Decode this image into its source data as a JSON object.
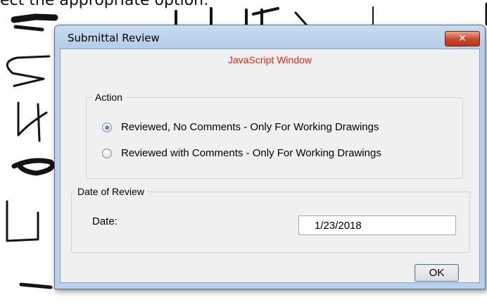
{
  "background": {
    "caption": "ect the appropriate option:"
  },
  "dialog": {
    "title": "Submittal Review",
    "close_label": "✕",
    "subtitle": "JavaScript Window",
    "action_group": {
      "legend": "Action",
      "options": [
        {
          "label": "Reviewed, No Comments - Only For Working Drawings",
          "checked": true
        },
        {
          "label": "Reviewed with Comments - Only For Working Drawings",
          "checked": false
        }
      ]
    },
    "date_group": {
      "legend": "Date of Review",
      "date_label": "Date:",
      "date_value": "1/23/2018"
    },
    "ok_label": "OK"
  },
  "colors": {
    "subtitle": "#e8221a",
    "window_frame": "#b9d1ea",
    "close_button": "#c9462c"
  }
}
